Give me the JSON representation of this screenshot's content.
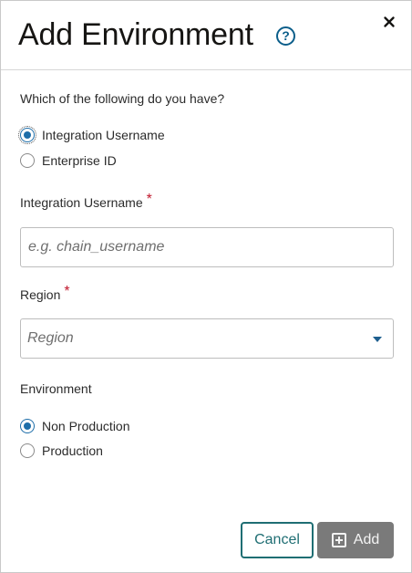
{
  "dialog": {
    "title": "Add Environment",
    "help_icon": "help-icon",
    "help_glyph": "?",
    "close_icon": "close-icon"
  },
  "credential_type": {
    "question": "Which of the following do you have?",
    "options": [
      {
        "label": "Integration Username",
        "selected": true
      },
      {
        "label": "Enterprise ID",
        "selected": false
      }
    ]
  },
  "integration_username": {
    "label": "Integration Username",
    "required_mark": "*",
    "value": "",
    "placeholder": "e.g. chain_username"
  },
  "region": {
    "label": "Region",
    "required_mark": "*",
    "placeholder": "Region"
  },
  "environment": {
    "label": "Environment",
    "options": [
      {
        "label": "Non Production",
        "selected": true
      },
      {
        "label": "Production",
        "selected": false
      }
    ]
  },
  "footer": {
    "cancel_label": "Cancel",
    "add_label": "Add",
    "add_icon": "plus-square-icon"
  },
  "colors": {
    "accent": "#1e6ea9",
    "cancel_border": "#1f6e73",
    "add_disabled_bg": "#7a7a7a",
    "required": "#c0172c"
  }
}
